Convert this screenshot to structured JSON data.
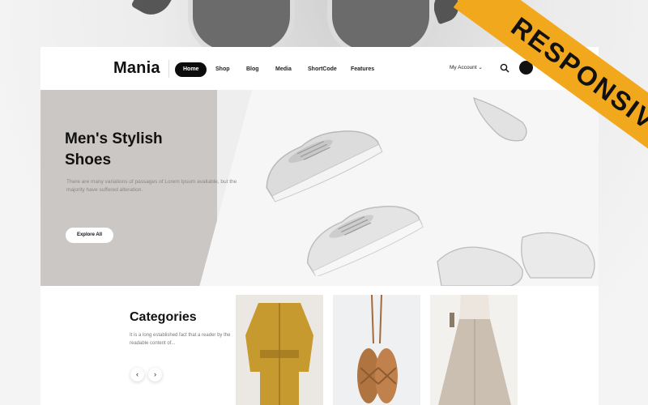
{
  "brand": {
    "logo": "Mania"
  },
  "nav": {
    "items": [
      {
        "label": "Home",
        "active": true
      },
      {
        "label": "Shop",
        "active": false
      },
      {
        "label": "Blog",
        "active": false
      },
      {
        "label": "Media",
        "active": false
      },
      {
        "label": "ShortCode",
        "active": false
      },
      {
        "label": "Features",
        "active": false
      }
    ],
    "account_label": "My Account",
    "account_chevron": "⌄"
  },
  "hero": {
    "title": "Men's Stylish\nShoes",
    "text": "There are many variations of passages of Lorem Ipsum available, but the majority have suffered alteration.",
    "button_label": "Explore All"
  },
  "categories": {
    "title": "Categories",
    "text": "It is a long established fact that a reader by the readable content of...",
    "prev_icon": "‹",
    "next_icon": "›"
  },
  "badge": {
    "label": "RESPONSIVE"
  },
  "colors": {
    "accent": "#f2a81d",
    "dark": "#0c0c0c",
    "hero_bg": "#cbc7c4"
  }
}
